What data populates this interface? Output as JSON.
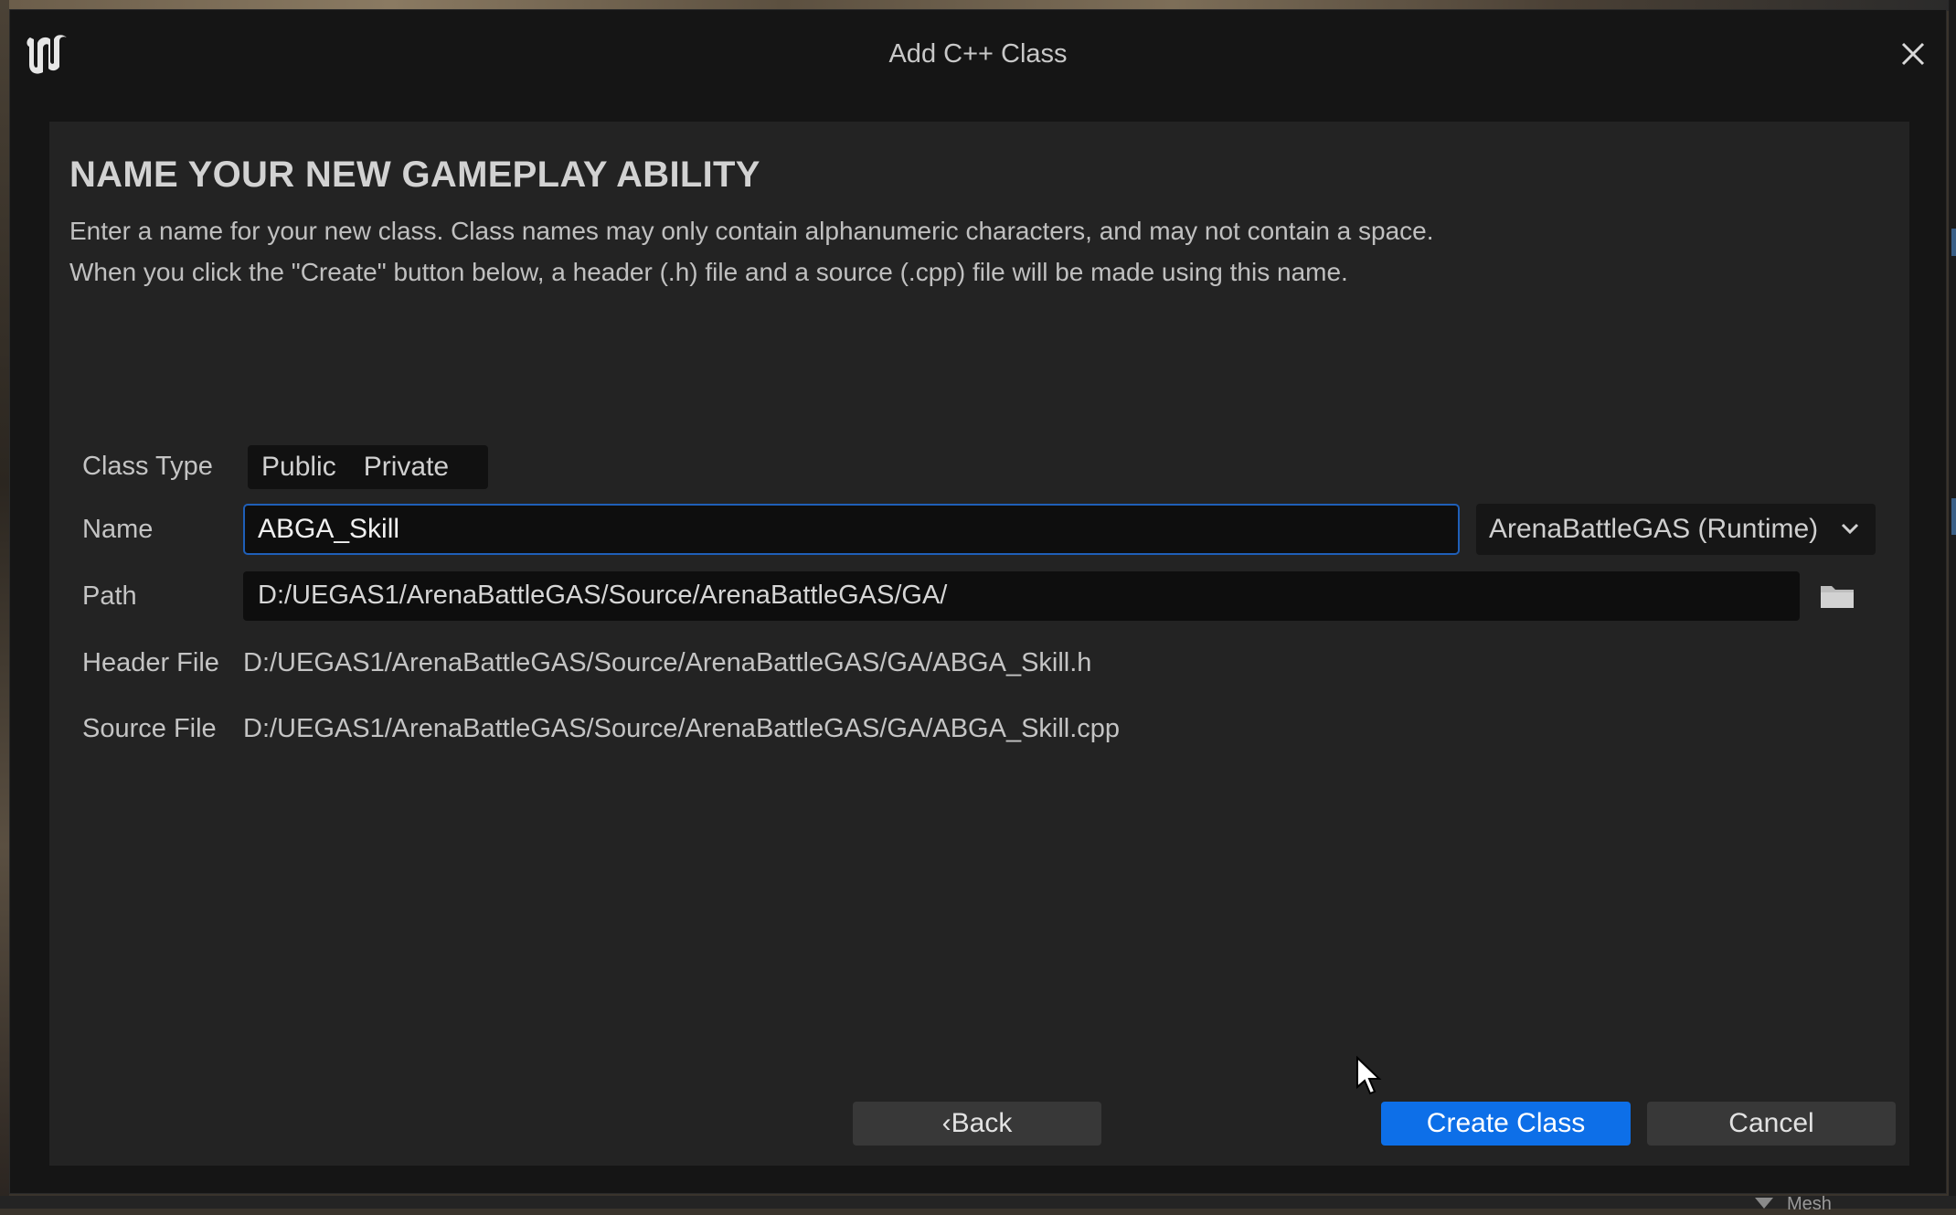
{
  "window": {
    "title": "Add C++ Class",
    "logo_icon": "unreal-engine-logo",
    "close_icon": "close-icon"
  },
  "page": {
    "heading": "NAME YOUR NEW GAMEPLAY ABILITY",
    "description_line1": "Enter a name for your new class. Class names may only contain alphanumeric characters, and may not contain a space.",
    "description_line2": "When you click the \"Create\" button below, a header (.h) file and a source (.cpp) file will be made using this name."
  },
  "form": {
    "class_type": {
      "label": "Class Type",
      "options": [
        "Public",
        "Private"
      ]
    },
    "name": {
      "label": "Name",
      "value": "ABGA_Skill"
    },
    "module": {
      "selected": "ArenaBattleGAS (Runtime)",
      "icon": "chevron-down-icon"
    },
    "path": {
      "label": "Path",
      "value": "D:/UEGAS1/ArenaBattleGAS/Source/ArenaBattleGAS/GA/",
      "icon": "folder-icon"
    },
    "header_file": {
      "label": "Header File",
      "value": "D:/UEGAS1/ArenaBattleGAS/Source/ArenaBattleGAS/GA/ABGA_Skill.h"
    },
    "source_file": {
      "label": "Source File",
      "value": "D:/UEGAS1/ArenaBattleGAS/Source/ArenaBattleGAS/GA/ABGA_Skill.cpp"
    }
  },
  "buttons": {
    "back": "‹Back",
    "create": "Create Class",
    "cancel": "Cancel"
  },
  "background": {
    "partial_label": "Mesh"
  },
  "colors": {
    "accent": "#0d6fe8",
    "input_focus_border": "#1f5fb8",
    "panel": "#232323",
    "window": "#151515"
  }
}
